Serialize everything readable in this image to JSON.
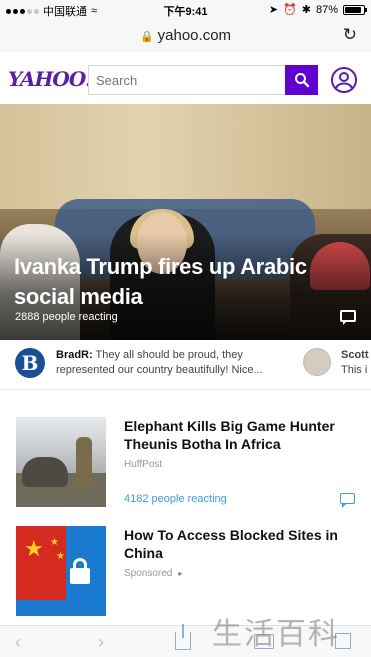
{
  "status_bar": {
    "carrier": "中国联通",
    "time": "下午9:41",
    "battery": "87%",
    "battery_level_percent": 87
  },
  "url_bar": {
    "domain": "yahoo.com"
  },
  "header": {
    "logo": "YAHOO!",
    "search_placeholder": "Search"
  },
  "hero": {
    "title": "Ivanka Trump fires up Arabic social media",
    "reacting": "2888 people reacting"
  },
  "comments": [
    {
      "author": "BradR:",
      "text": "They all should be proud, they represented our country beautifully! Nice...",
      "avatar_letter": "B"
    },
    {
      "author": "Scott",
      "text": "This i"
    }
  ],
  "articles": [
    {
      "title": "Elephant Kills Big Game Hunter Theunis Botha In Africa",
      "source": "HuffPost",
      "reacting": "4182 people reacting"
    },
    {
      "title": "How To Access Blocked Sites in China",
      "source": "Sponsored"
    }
  ],
  "watermark": "生活百科",
  "colors": {
    "brand_purple": "#5f01d1",
    "link_blue": "#3f9ae3"
  }
}
